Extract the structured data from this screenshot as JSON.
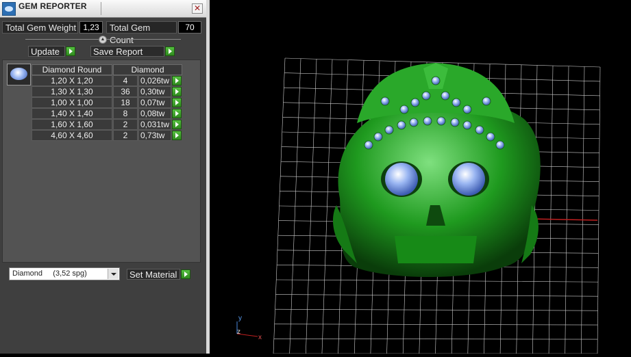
{
  "window": {
    "title": "GEM REPORTER",
    "close_glyph": "✕"
  },
  "totals": {
    "weight_label": "Total Gem Weight",
    "weight_value": "1,23",
    "count_label": "Total Gem Count",
    "count_value": "70"
  },
  "toolbar": {
    "update_label": "Update",
    "save_label": "Save Report"
  },
  "table": {
    "headers": [
      "Diamond Round",
      "Diamond"
    ],
    "rows": [
      {
        "size": "1,20 X 1,20",
        "count": "4",
        "weight": "0,026tw"
      },
      {
        "size": "1,30 X 1,30",
        "count": "36",
        "weight": "0,30tw"
      },
      {
        "size": "1,00 X 1,00",
        "count": "18",
        "weight": "0,07tw"
      },
      {
        "size": "1,40 X 1,40",
        "count": "8",
        "weight": "0,08tw"
      },
      {
        "size": "1,60 X 1,60",
        "count": "2",
        "weight": "0,031tw"
      },
      {
        "size": "4,60 X 4,60",
        "count": "2",
        "weight": "0,73tw"
      }
    ]
  },
  "material": {
    "selected": "Diamond     (3,52 spg)",
    "set_label": "Set Material"
  },
  "viewport": {
    "axis_y": "y",
    "axis_z": "z",
    "axis_x": "x",
    "model_color": "#1f9a1f",
    "gem_color": "#9ab6f2",
    "grid_color": "#d0d0d0"
  }
}
